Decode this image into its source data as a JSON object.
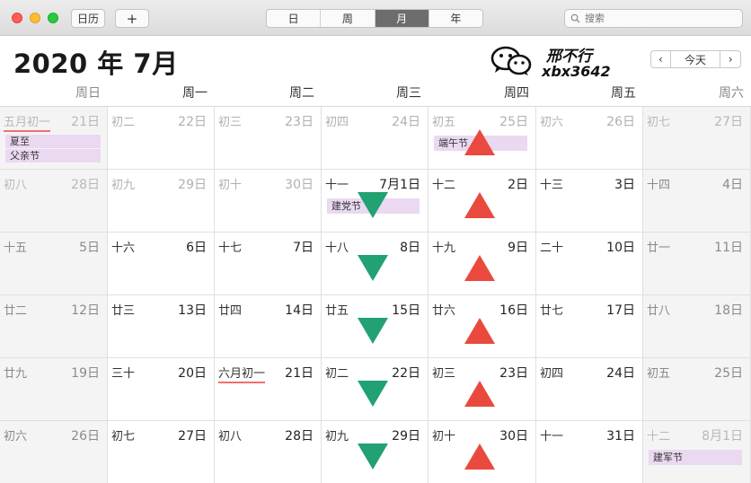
{
  "titlebar": {
    "calendars_label": "日历",
    "add_label": "+",
    "views": [
      "日",
      "周",
      "月",
      "年"
    ],
    "active_view": "月",
    "search_placeholder": "搜索"
  },
  "header": {
    "month_title": "2020 年 7月",
    "watermark_name": "邢不行",
    "watermark_id": "xbx3642",
    "nav_prev": "‹",
    "nav_today": "今天",
    "nav_next": "›"
  },
  "weekdays": [
    "周日",
    "周一",
    "周二",
    "周三",
    "周四",
    "周五",
    "周六"
  ],
  "weeks": [
    [
      {
        "lunar": "五月初一",
        "solar": "21日",
        "dim": true,
        "lunar_red_underline": true,
        "events": [
          "夏至",
          "父亲节"
        ]
      },
      {
        "lunar": "初二",
        "solar": "22日",
        "dim": true
      },
      {
        "lunar": "初三",
        "solar": "23日",
        "dim": true
      },
      {
        "lunar": "初四",
        "solar": "24日",
        "dim": true
      },
      {
        "lunar": "初五",
        "solar": "25日",
        "dim": true,
        "events": [
          "端午节"
        ]
      },
      {
        "lunar": "初六",
        "solar": "26日",
        "dim": true
      },
      {
        "lunar": "初七",
        "solar": "27日",
        "dim": true
      }
    ],
    [
      {
        "lunar": "初八",
        "solar": "28日",
        "dim": true
      },
      {
        "lunar": "初九",
        "solar": "29日",
        "dim": true
      },
      {
        "lunar": "初十",
        "solar": "30日",
        "dim": true
      },
      {
        "lunar": "十一",
        "solar": "7月1日",
        "events": [
          "建党节"
        ]
      },
      {
        "lunar": "十二",
        "solar": "2日"
      },
      {
        "lunar": "十三",
        "solar": "3日"
      },
      {
        "lunar": "十四",
        "solar": "4日"
      }
    ],
    [
      {
        "lunar": "十五",
        "solar": "5日"
      },
      {
        "lunar": "十六",
        "solar": "6日"
      },
      {
        "lunar": "十七",
        "solar": "7日"
      },
      {
        "lunar": "十八",
        "solar": "8日"
      },
      {
        "lunar": "十九",
        "solar": "9日"
      },
      {
        "lunar": "二十",
        "solar": "10日"
      },
      {
        "lunar": "廿一",
        "solar": "11日"
      }
    ],
    [
      {
        "lunar": "廿二",
        "solar": "12日"
      },
      {
        "lunar": "廿三",
        "solar": "13日"
      },
      {
        "lunar": "廿四",
        "solar": "14日"
      },
      {
        "lunar": "廿五",
        "solar": "15日"
      },
      {
        "lunar": "廿六",
        "solar": "16日"
      },
      {
        "lunar": "廿七",
        "solar": "17日"
      },
      {
        "lunar": "廿八",
        "solar": "18日"
      }
    ],
    [
      {
        "lunar": "廿九",
        "solar": "19日"
      },
      {
        "lunar": "三十",
        "solar": "20日"
      },
      {
        "lunar": "六月初一",
        "solar": "21日",
        "lunar_red_underline": true
      },
      {
        "lunar": "初二",
        "solar": "22日"
      },
      {
        "lunar": "初三",
        "solar": "23日"
      },
      {
        "lunar": "初四",
        "solar": "24日"
      },
      {
        "lunar": "初五",
        "solar": "25日"
      }
    ],
    [
      {
        "lunar": "初六",
        "solar": "26日"
      },
      {
        "lunar": "初七",
        "solar": "27日"
      },
      {
        "lunar": "初八",
        "solar": "28日"
      },
      {
        "lunar": "初九",
        "solar": "29日"
      },
      {
        "lunar": "初十",
        "solar": "30日"
      },
      {
        "lunar": "十一",
        "solar": "31日"
      },
      {
        "lunar": "十二",
        "solar": "8月1日",
        "dim": true,
        "events": [
          "建军节"
        ]
      }
    ]
  ],
  "annotations": {
    "wednesday_arrows": {
      "direction": "down",
      "color": "#22a173",
      "weeks": [
        2,
        3,
        4,
        5,
        6
      ]
    },
    "thursday_arrows": {
      "direction": "up",
      "color": "#ea4a3e",
      "weeks": [
        1,
        2,
        3,
        4,
        5,
        6
      ]
    }
  },
  "colors": {
    "event_bg": "#ead9f1",
    "active_segment": "#6d6d6d",
    "lunar_underline": "#f07070"
  }
}
